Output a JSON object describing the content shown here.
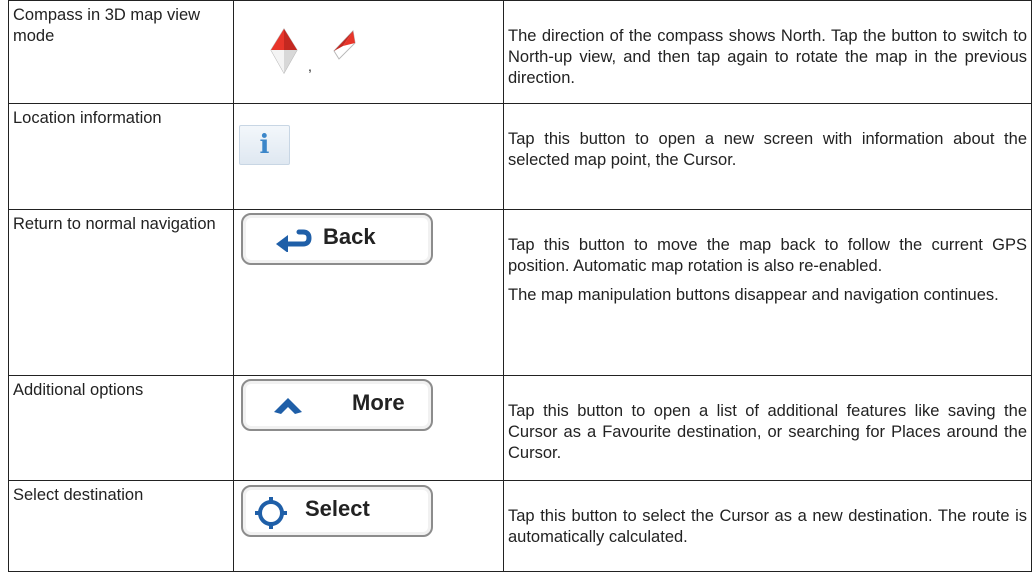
{
  "rows": [
    {
      "name": "Compass in 3D map view mode",
      "separator": ",",
      "description": [
        "The direction of the compass shows North. Tap the button to switch to North-up view, and then tap again to rotate the map in the previous direction."
      ]
    },
    {
      "name": "Location information",
      "icon": "info-icon",
      "description": [
        "Tap this button to open a new screen with information about the selected map point, the Cursor."
      ]
    },
    {
      "name": "Return to normal navigation",
      "button_label": "Back",
      "icon": "return-arrow-icon",
      "description": [
        "Tap this button to move the map back to follow the current GPS position. Automatic map rotation is also re-enabled.",
        "The map manipulation buttons disappear and navigation continues."
      ]
    },
    {
      "name": "Additional options",
      "button_label": "More",
      "icon": "chevron-up-icon",
      "description": [
        "Tap this button to open a list of additional features like saving the Cursor as a Favourite destination, or searching for Places around the Cursor."
      ]
    },
    {
      "name": "Select destination",
      "button_label": "Select",
      "icon": "target-icon",
      "description": [
        "Tap this button to select the Cursor as a new destination. The route is automatically calculated."
      ]
    }
  ],
  "colors": {
    "compass_red": "#e8352a",
    "icon_blue": "#1f5fa8",
    "info_blue": "#3b86c9",
    "button_border": "#8c8c8c"
  }
}
